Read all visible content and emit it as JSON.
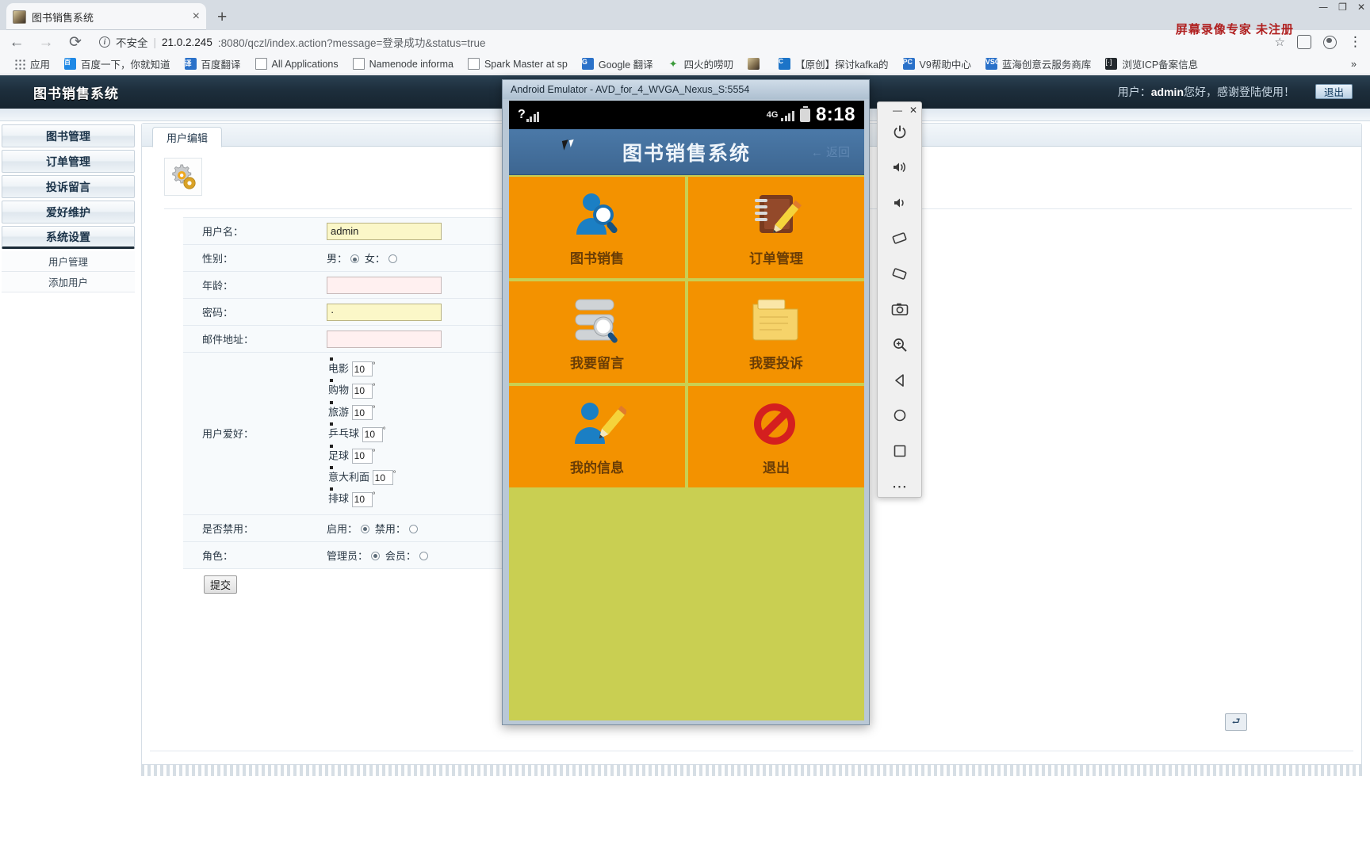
{
  "browser": {
    "tab": {
      "title": "图书销售系统",
      "close_label": "×",
      "favicon": "book-favicon"
    },
    "new_tab_label": "+",
    "window_controls": [
      "—",
      "❐",
      "✕"
    ],
    "nav": {
      "back": "←",
      "forward": "→",
      "reload": "⟳"
    },
    "omnibox": {
      "security_label": "不安全",
      "url_host": "21.0.2.245",
      "url_path": ":8080/qczl/index.action?message=登录成功&status=true",
      "separator": "|"
    },
    "toolbar_icons": {
      "star": "☆",
      "avatar": "avatar-icon",
      "menu": "⋮"
    },
    "bookmarks": [
      {
        "label": "应用",
        "icon": "apps-grid-icon"
      },
      {
        "label": "百度一下，你就知道",
        "icon": "baidu-icon",
        "badge": "百"
      },
      {
        "label": "百度翻译",
        "icon": "translate-icon",
        "badge": "译"
      },
      {
        "label": "All Applications",
        "icon": "document-icon"
      },
      {
        "label": "Namenode informa",
        "icon": "document-icon"
      },
      {
        "label": "Spark Master at sp",
        "icon": "document-icon"
      },
      {
        "label": "Google 翻译",
        "icon": "google-translate-icon",
        "badge": "G"
      },
      {
        "label": "四火的唠叨",
        "icon": "star-green-icon"
      },
      {
        "label": "",
        "icon": "book-favicon"
      },
      {
        "label": "【原创】探讨kafka的",
        "icon": "csdn-icon",
        "badge": "C"
      },
      {
        "label": "V9帮助中心",
        "icon": "pc-icon",
        "badge": "PC"
      },
      {
        "label": "蓝海创意云服务商库",
        "icon": "vso-icon",
        "badge": "VSO"
      },
      {
        "label": "浏览ICP备案信息",
        "icon": "icp-icon",
        "badge": "[·]"
      }
    ],
    "watermark": "屏幕录像专家  未注册"
  },
  "app": {
    "title": "图书销售系统",
    "user_greeting_prefix": "用户：",
    "user_name": "admin",
    "user_greeting_suffix": "您好，感谢登陆使用！",
    "logout_label": "退出"
  },
  "sidebar": {
    "main_items": [
      {
        "label": "图书管理"
      },
      {
        "label": "订单管理"
      },
      {
        "label": "投诉留言"
      },
      {
        "label": "爱好维护"
      },
      {
        "label": "系统设置"
      }
    ],
    "sub_items": [
      {
        "label": "用户管理"
      },
      {
        "label": "添加用户"
      }
    ]
  },
  "content": {
    "tab_label": "用户编辑",
    "gear_icon": "gears-icon",
    "form": {
      "username": {
        "label": "用户名：",
        "value": "admin"
      },
      "gender": {
        "label": "性别：",
        "male_label": "男：",
        "female_label": "女：",
        "selected": "male"
      },
      "age": {
        "label": "年龄：",
        "value": ""
      },
      "password": {
        "label": "密码：",
        "value": "·"
      },
      "email": {
        "label": "邮件地址：",
        "value": ""
      },
      "hobby": {
        "label": "用户爱好：",
        "unit": "°",
        "items": [
          {
            "name": "电影",
            "value": "10"
          },
          {
            "name": "购物",
            "value": "10"
          },
          {
            "name": "旅游",
            "value": "10"
          },
          {
            "name": "乒乓球",
            "value": "10"
          },
          {
            "name": "足球",
            "value": "10"
          },
          {
            "name": "意大利面",
            "value": "10"
          },
          {
            "name": "排球",
            "value": "10"
          }
        ]
      },
      "disabled": {
        "label": "是否禁用：",
        "enable_label": "启用：",
        "disable_label": "禁用：",
        "selected": "enable"
      },
      "role": {
        "label": "角色：",
        "admin_label": "管理员：",
        "member_label": "会员：",
        "selected": "admin"
      },
      "submit_label": "提交"
    }
  },
  "emulator": {
    "window_title": "Android Emulator - AVD_for_4_WVGA_Nexus_S:5554",
    "status": {
      "signal": "?",
      "network": "4G",
      "time": "8:18",
      "battery": "battery-icon"
    },
    "appbar_title": "图书销售系统",
    "back_label": "← 返回",
    "tiles": [
      {
        "label": "图书销售",
        "icon": "user-search-icon"
      },
      {
        "label": "订单管理",
        "icon": "notebook-pencil-icon"
      },
      {
        "label": "我要留言",
        "icon": "list-search-icon"
      },
      {
        "label": "我要投诉",
        "icon": "folder-icon"
      },
      {
        "label": "我的信息",
        "icon": "user-edit-icon"
      },
      {
        "label": "退出",
        "icon": "forbidden-icon"
      }
    ],
    "colors": {
      "tile": "#f39200",
      "background": "#c9cf52",
      "appbar": "#4b79a8"
    },
    "toolbar": {
      "window_controls": [
        "—",
        "✕"
      ],
      "buttons": [
        {
          "name": "power-icon",
          "glyph": "⏻"
        },
        {
          "name": "volume-up-icon",
          "glyph": "🔊"
        },
        {
          "name": "volume-down-icon",
          "glyph": "🔉"
        },
        {
          "name": "rotate-left-icon",
          "glyph": "◳"
        },
        {
          "name": "rotate-right-icon",
          "glyph": "◰"
        },
        {
          "name": "screenshot-camera-icon",
          "glyph": "📷"
        },
        {
          "name": "zoom-icon",
          "glyph": "🔍"
        },
        {
          "name": "back-nav-icon",
          "glyph": "◁"
        },
        {
          "name": "home-nav-icon",
          "glyph": "○"
        },
        {
          "name": "overview-nav-icon",
          "glyph": "□"
        },
        {
          "name": "more-options-icon",
          "glyph": "⋯"
        }
      ]
    }
  },
  "taskbar": {
    "restore_label": "⮐"
  }
}
